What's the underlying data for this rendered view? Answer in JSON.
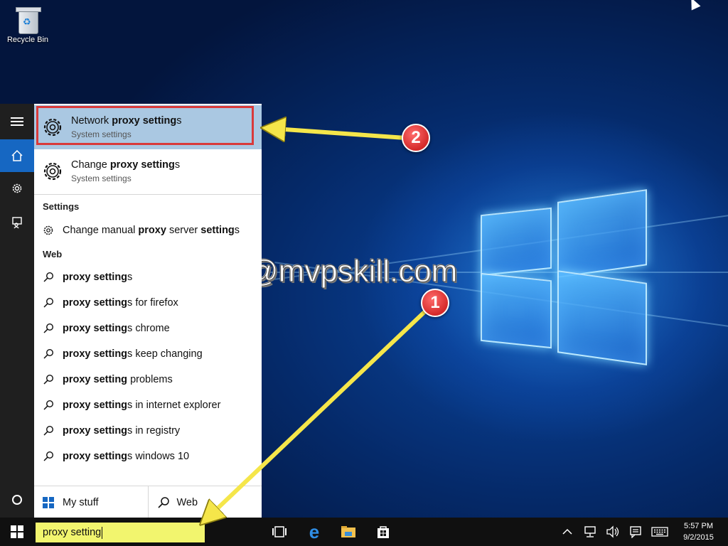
{
  "desktop": {
    "recycle_bin_label": "Recycle Bin",
    "watermark": "@mvpskill.com"
  },
  "search_panel": {
    "best_match": {
      "title_pre": "Network ",
      "title_bold": "proxy setting",
      "title_post": "s",
      "subtitle": "System settings"
    },
    "second_result": {
      "title_pre": "Change ",
      "title_bold": "proxy setting",
      "title_post": "s",
      "subtitle": "System settings"
    },
    "settings_section": {
      "label": "Settings",
      "items": [
        {
          "pre": "Change manual ",
          "bold1": "proxy",
          "mid": " server ",
          "bold2": "setting",
          "post": "s"
        }
      ]
    },
    "web_section": {
      "label": "Web",
      "items": [
        {
          "bold": "proxy setting",
          "rest": "s"
        },
        {
          "bold": "proxy setting",
          "rest": "s for firefox"
        },
        {
          "bold": "proxy setting",
          "rest": "s chrome"
        },
        {
          "bold": "proxy setting",
          "rest": "s keep changing"
        },
        {
          "bold": "proxy setting",
          "rest": " problems"
        },
        {
          "bold": "proxy setting",
          "rest": "s in internet explorer"
        },
        {
          "bold": "proxy setting",
          "rest": "s in registry"
        },
        {
          "bold": "proxy setting",
          "rest": "s windows 10"
        }
      ]
    },
    "tabs": {
      "my_stuff": "My stuff",
      "web": "Web"
    }
  },
  "taskbar": {
    "search_text": "proxy setting",
    "clock_time": "5:57 PM",
    "clock_date": "9/2/2015"
  },
  "annotations": {
    "step1": "1",
    "step2": "2"
  },
  "colors": {
    "highlight": "#aac8e2",
    "callout_red": "#d93a3a",
    "arrow_yellow": "#f5e64a",
    "accent": "#1667c2"
  },
  "icons": {
    "rail": [
      "hamburger-icon",
      "home-icon",
      "gear-icon",
      "feedback-icon",
      "cortana-icon"
    ],
    "taskbar": [
      "windows-start-icon",
      "task-view-icon",
      "edge-icon",
      "file-explorer-icon",
      "store-icon",
      "chevron-up-icon",
      "network-icon",
      "volume-icon",
      "notification-icon",
      "keyboard-icon"
    ]
  }
}
